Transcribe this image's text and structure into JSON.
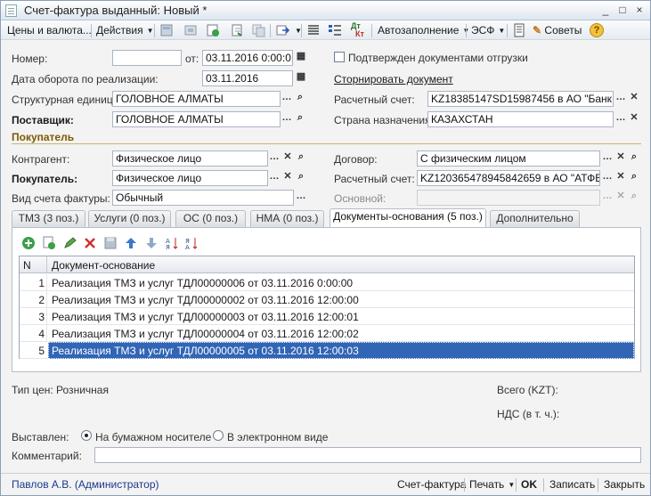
{
  "window": {
    "title": "Счет-фактура выданный: Новый *",
    "controls": [
      "_",
      "□",
      "×"
    ]
  },
  "toolbar": {
    "prices_label": "Цены и валюта...",
    "actions_label": "Действия",
    "autofill_label": "Автозаполнение",
    "esf_label": "ЭСФ",
    "tips_label": "Советы",
    "dtkt_label": "Дт Кт"
  },
  "header": {
    "number_label": "Номер:",
    "number_value": "",
    "from_label": "от:",
    "date_value": "03.11.2016  0:00:01",
    "confirmed_label": "Подтвержден документами отгрузки",
    "turnover_label": "Дата оборота по реализации:",
    "turnover_value": "03.11.2016",
    "storno_link": "Сторнировать документ",
    "unit_label": "Структурная единица:",
    "unit_value": "ГОЛОВНОЕ АЛМАТЫ",
    "account_label": "Расчетный счет:",
    "account_value": "KZ18385147SD15987456 в АО \"Банк Ц",
    "supplier_label": "Поставщик:",
    "supplier_value": "ГОЛОВНОЕ АЛМАТЫ",
    "country_label": "Страна назначения:",
    "country_value": "КАЗАХСТАН"
  },
  "buyer": {
    "section_title": "Покупатель",
    "counterparty_label": "Контрагент:",
    "counterparty_value": "Физическое лицо",
    "contract_label": "Договор:",
    "contract_value": "С физическим лицом",
    "buyer_label": "Покупатель:",
    "buyer_value": "Физическое лицо",
    "buyer_account_label": "Расчетный счет:",
    "buyer_account_value": "KZ120365478945842659 в АО \"АТФБанк",
    "invoice_type_label": "Вид счета фактуры:",
    "invoice_type_value": "Обычный",
    "main_label": "Основной:",
    "main_value": ""
  },
  "tabs": [
    {
      "label": "ТМЗ (3 поз.)"
    },
    {
      "label": "Услуги (0 поз.)"
    },
    {
      "label": "ОС (0 поз.)"
    },
    {
      "label": "НМА (0 поз.)"
    },
    {
      "label": "Документы-основания (5 поз.)"
    },
    {
      "label": "Дополнительно"
    }
  ],
  "grid": {
    "col_n": "N",
    "col_doc": "Документ-основание",
    "rows": [
      {
        "n": "1",
        "doc": "Реализация ТМЗ и услуг ТДЛ00000006 от 03.11.2016 0:00:00"
      },
      {
        "n": "2",
        "doc": "Реализация ТМЗ и услуг ТДЛ00000002 от 03.11.2016 12:00:00"
      },
      {
        "n": "3",
        "doc": "Реализация ТМЗ и услуг ТДЛ00000003 от 03.11.2016 12:00:01"
      },
      {
        "n": "4",
        "doc": "Реализация ТМЗ и услуг ТДЛ00000004 от 03.11.2016 12:00:02"
      },
      {
        "n": "5",
        "doc": "Реализация ТМЗ и услуг ТДЛ00000005 от 03.11.2016 12:00:03"
      }
    ]
  },
  "footer": {
    "price_type": "Тип цен: Розничная",
    "total_label": "Всего (KZT):",
    "vat_label": "НДС (в т. ч.):",
    "issued_label": "Выставлен:",
    "paper_label": "На бумажном носителе",
    "electronic_label": "В электронном виде",
    "comment_label": "Комментарий:",
    "comment_value": ""
  },
  "statusbar": {
    "user": "Павлов А.В. (Администратор)",
    "invoice": "Счет-фактура",
    "print": "Печать",
    "ok": "OK",
    "save": "Записать",
    "close": "Закрыть"
  },
  "colors": {
    "selection": "#3165b5",
    "section": "#7a5a00",
    "link_user": "#1a3a8a"
  }
}
